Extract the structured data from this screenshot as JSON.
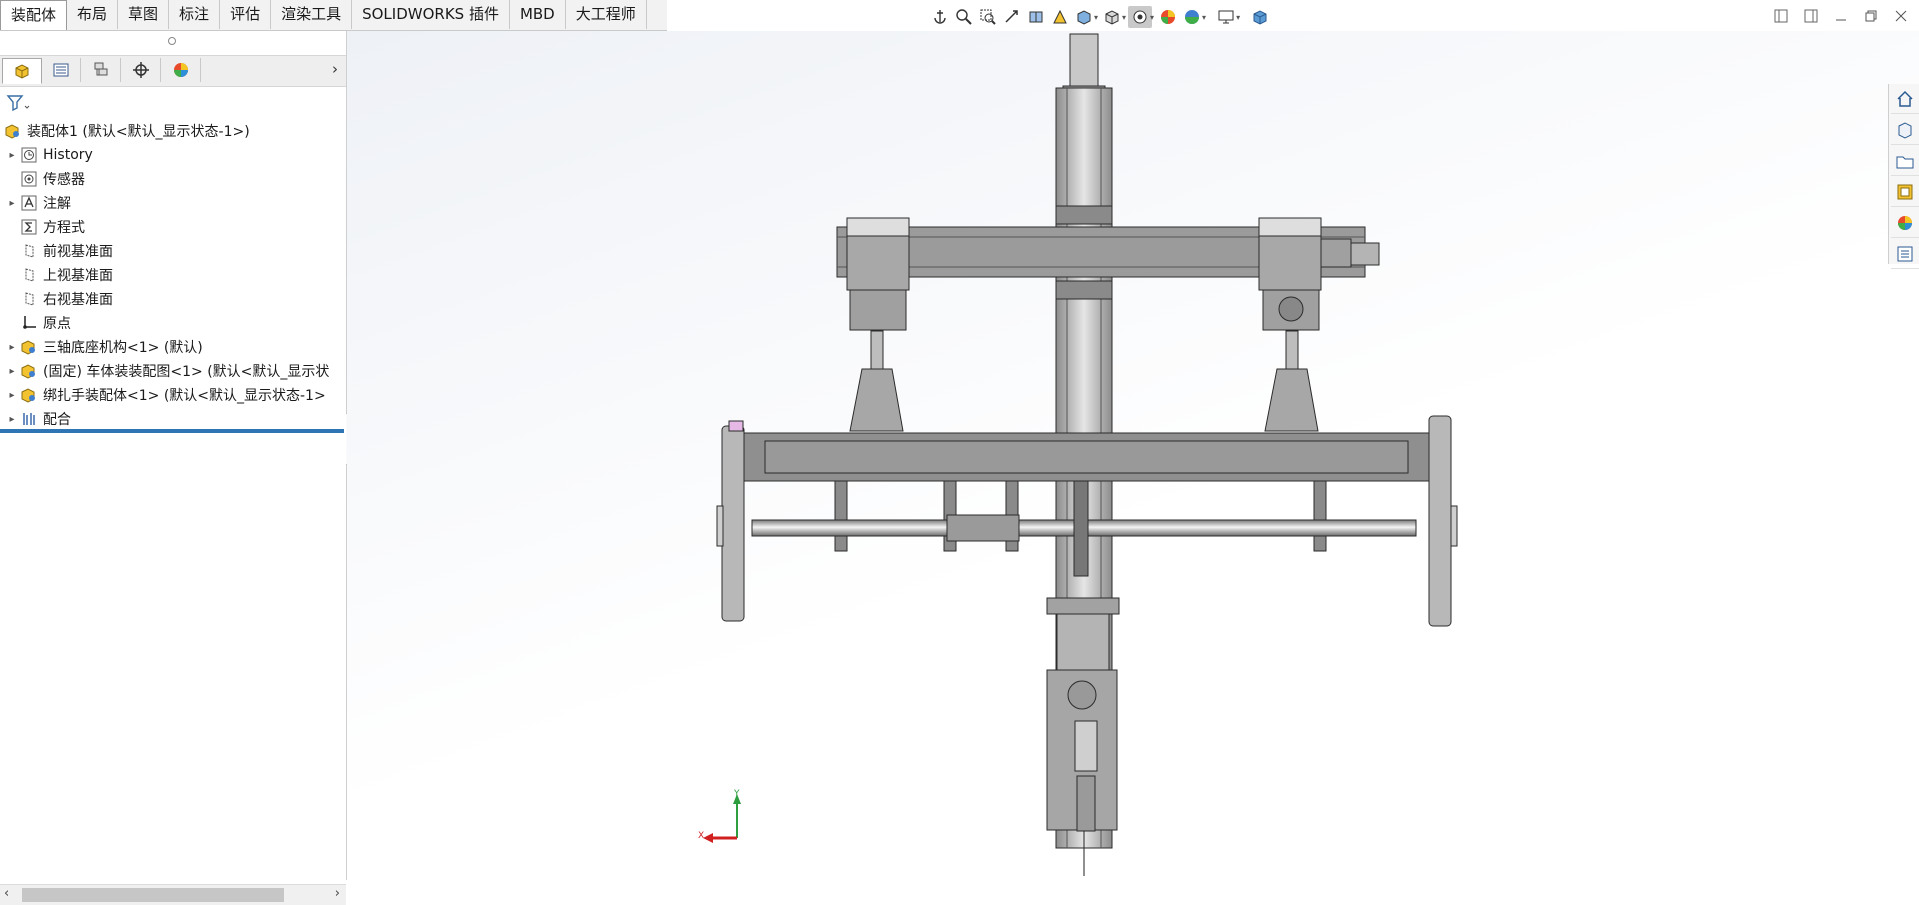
{
  "ribbon": {
    "tabs": [
      "装配体",
      "布局",
      "草图",
      "标注",
      "评估",
      "渲染工具",
      "SOLIDWORKS 插件",
      "MBD",
      "大工程师"
    ],
    "active_tab": "装配体"
  },
  "feature_tree": {
    "items": [
      {
        "label": "装配体1  (默认<默认_显示状态-1>)",
        "icon": "assembly-icon",
        "expander": false
      },
      {
        "label": "History",
        "icon": "history-icon",
        "expander": true
      },
      {
        "label": "传感器",
        "icon": "sensor-icon",
        "expander": false
      },
      {
        "label": "注解",
        "icon": "annotations-icon",
        "expander": true
      },
      {
        "label": "方程式",
        "icon": "equations-icon",
        "expander": false
      },
      {
        "label": "前视基准面",
        "icon": "plane-icon",
        "expander": false
      },
      {
        "label": "上视基准面",
        "icon": "plane-icon",
        "expander": false
      },
      {
        "label": "右视基准面",
        "icon": "plane-icon",
        "expander": false
      },
      {
        "label": "原点",
        "icon": "origin-icon",
        "expander": false
      },
      {
        "label": "三轴底座机构<1> (默认)",
        "icon": "subassembly-icon",
        "expander": true
      },
      {
        "label": "(固定) 车体装装配图<1> (默认<默认_显示状",
        "icon": "subassembly-icon",
        "expander": true
      },
      {
        "label": "绑扎手装配体<1> (默认<默认_显示状态-1>",
        "icon": "subassembly-icon",
        "expander": true
      },
      {
        "label": "配合",
        "icon": "mates-icon",
        "expander": true
      }
    ]
  },
  "triad": {
    "x_label": "X",
    "y_label": "Y"
  },
  "colors": {
    "accent": "#2e75b6",
    "model_gray": "#9b9b9b"
  }
}
